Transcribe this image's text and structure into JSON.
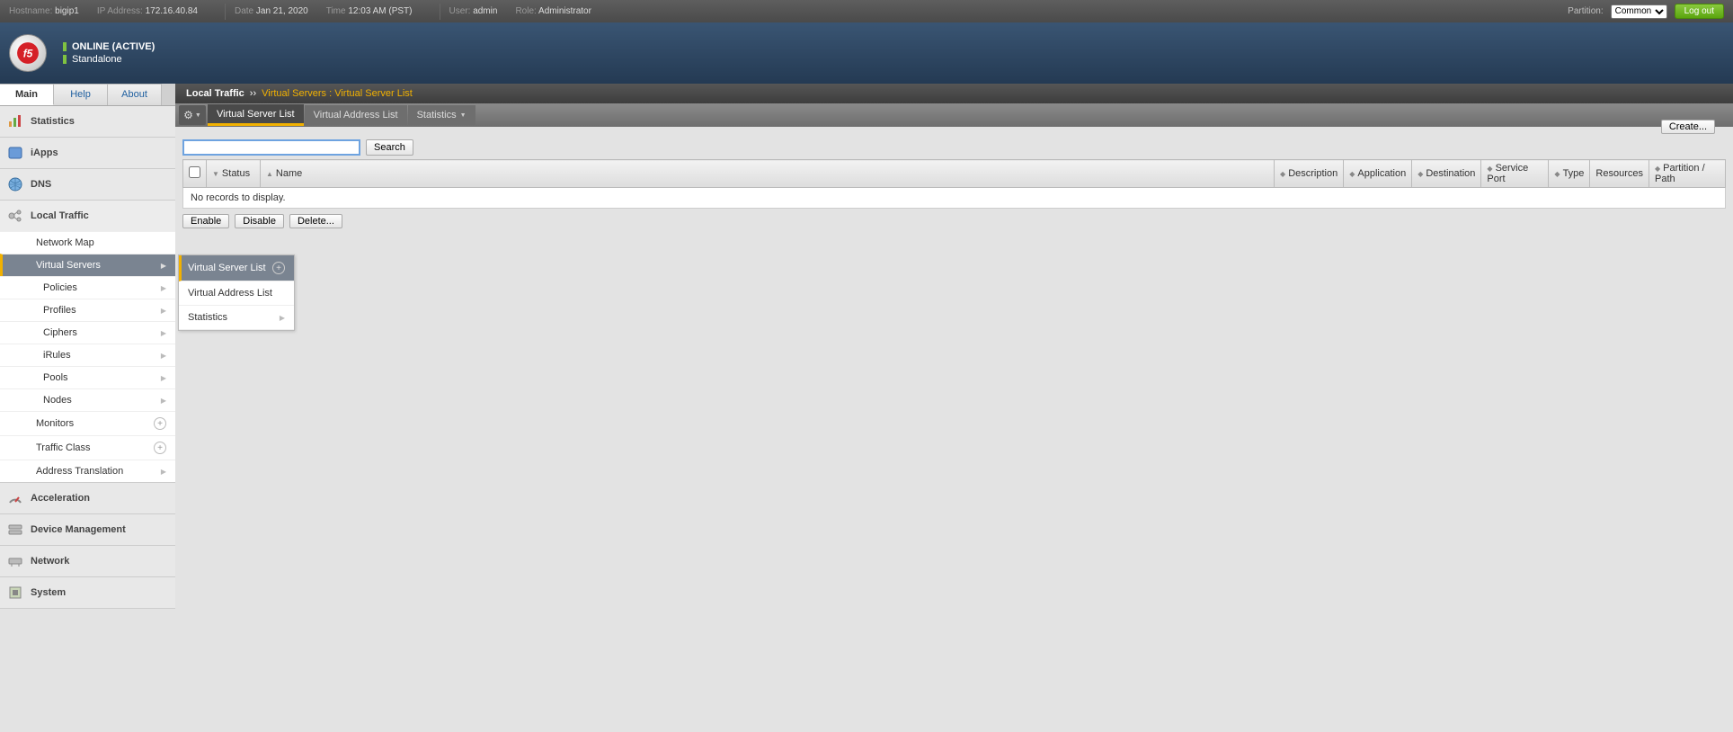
{
  "top": {
    "hostname_label": "Hostname:",
    "hostname": "bigip1",
    "ip_label": "IP Address:",
    "ip": "172.16.40.84",
    "date_label": "Date",
    "date": "Jan 21, 2020",
    "time_label": "Time",
    "time": "12:03 AM (PST)",
    "user_label": "User:",
    "user": "admin",
    "role_label": "Role:",
    "role": "Administrator",
    "partition_label": "Partition:",
    "partition_value": "Common",
    "logout": "Log out"
  },
  "status": {
    "online": "ONLINE (ACTIVE)",
    "mode": "Standalone"
  },
  "tabs": {
    "main": "Main",
    "help": "Help",
    "about": "About"
  },
  "nav": {
    "statistics": "Statistics",
    "iapps": "iApps",
    "dns": "DNS",
    "local_traffic": "Local Traffic",
    "lt": {
      "network_map": "Network Map",
      "virtual_servers": "Virtual Servers",
      "policies": "Policies",
      "profiles": "Profiles",
      "ciphers": "Ciphers",
      "irules": "iRules",
      "pools": "Pools",
      "nodes": "Nodes",
      "monitors": "Monitors",
      "traffic_class": "Traffic Class",
      "address_translation": "Address Translation"
    },
    "flyout": {
      "vs_list": "Virtual Server List",
      "va_list": "Virtual Address List",
      "stats": "Statistics"
    },
    "acceleration": "Acceleration",
    "dev_mgmt": "Device Management",
    "network": "Network",
    "system": "System"
  },
  "bc": {
    "l1": "Local Traffic",
    "sep": "››",
    "l2": "Virtual Servers : Virtual Server List"
  },
  "subtabs": {
    "vs_list": "Virtual Server List",
    "va_list": "Virtual Address List",
    "stats": "Statistics"
  },
  "search": {
    "btn": "Search",
    "create": "Create...",
    "value": ""
  },
  "cols": {
    "status": "Status",
    "name": "Name",
    "description": "Description",
    "application": "Application",
    "destination": "Destination",
    "service_port": "Service Port",
    "type": "Type",
    "resources": "Resources",
    "partition": "Partition / Path"
  },
  "empty": "No records to display.",
  "actions": {
    "enable": "Enable",
    "disable": "Disable",
    "delete": "Delete..."
  }
}
